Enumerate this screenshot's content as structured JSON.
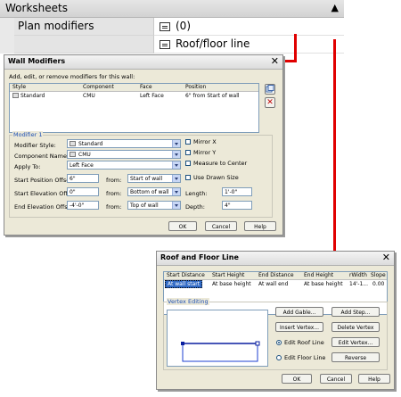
{
  "palette": {
    "section_title": "Worksheets",
    "rows": [
      {
        "name": "Plan modifiers",
        "value": "(0)"
      },
      {
        "name": "",
        "value": "Roof/floor line"
      }
    ]
  },
  "wall_modifiers": {
    "title": "Wall Modifiers",
    "instruction": "Add, edit, or remove modifiers for this wall:",
    "columns": [
      "Style",
      "Component",
      "Face",
      "Position"
    ],
    "rows": [
      {
        "style": "Standard",
        "component": "CMU",
        "face": "Left Face",
        "position": "6\" from Start of wall"
      }
    ],
    "group_title": "Modifier 1",
    "labels": {
      "modifier_style": "Modifier Style:",
      "component_name": "Component Name:",
      "apply_to": "Apply To:",
      "start_position_offset": "Start Position Offset:",
      "start_elevation_offset": "Start Elevation Offset:",
      "end_elevation_offset": "End Elevation Offset:",
      "from1": "from:",
      "from2": "from:",
      "from3": "from:",
      "length": "Length:",
      "depth": "Depth:"
    },
    "values": {
      "modifier_style": "Standard",
      "component_name": "CMU",
      "apply_to": "Left Face",
      "start_position_offset": "6\"",
      "start_elevation_offset": "0\"",
      "end_elevation_offset": "-4'-0\"",
      "from_start": "Start of wall",
      "from_bottom": "Bottom of wall",
      "from_top": "Top of wall",
      "length": "1'-0\"",
      "depth": "4\""
    },
    "checkboxes": {
      "mirror_x": "Mirror X",
      "mirror_y": "Mirror Y",
      "measure_to_center": "Measure to Center",
      "use_drawn_size": "Use Drawn Size"
    },
    "buttons": {
      "ok": "OK",
      "cancel": "Cancel",
      "help": "Help"
    }
  },
  "roof_floor_line": {
    "title": "Roof and Floor Line",
    "columns": [
      "Start Distance",
      "Start Height",
      "End Distance",
      "End Height",
      "rWidth",
      "Slope"
    ],
    "rows": [
      {
        "start_distance": "At wall start",
        "start_height": "At base height",
        "end_distance": "At wall end",
        "end_height": "At base height",
        "width": "14'-1...",
        "slope": "0.00"
      }
    ],
    "vertex_group": "Vertex Editing",
    "buttons": {
      "add_gable": "Add Gable...",
      "add_step": "Add Step...",
      "insert_vertex": "Insert Vertex...",
      "delete_vertex": "Delete Vertex",
      "edit_vertex": "Edit Vertex...",
      "reverse": "Reverse",
      "ok": "OK",
      "cancel": "Cancel",
      "help": "Help"
    },
    "radios": {
      "edit_roof_line": "Edit Roof Line",
      "edit_floor_line": "Edit Floor Line"
    },
    "selected_radio": "edit_roof_line"
  },
  "colors": {
    "callout": "#e00000",
    "selection": "#316ac5"
  }
}
